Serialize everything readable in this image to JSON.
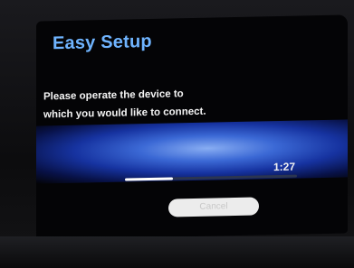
{
  "dialog": {
    "title": "Easy Setup",
    "instruction_line1": "Please operate the device to",
    "instruction_line2": "which you would like to connect.",
    "countdown": "1:27",
    "progress_fraction": 0.28,
    "cancel_label": "Cancel"
  },
  "colors": {
    "title": "#6fb4ff",
    "band_center": "#3e6ee0",
    "button": "#ececec"
  }
}
